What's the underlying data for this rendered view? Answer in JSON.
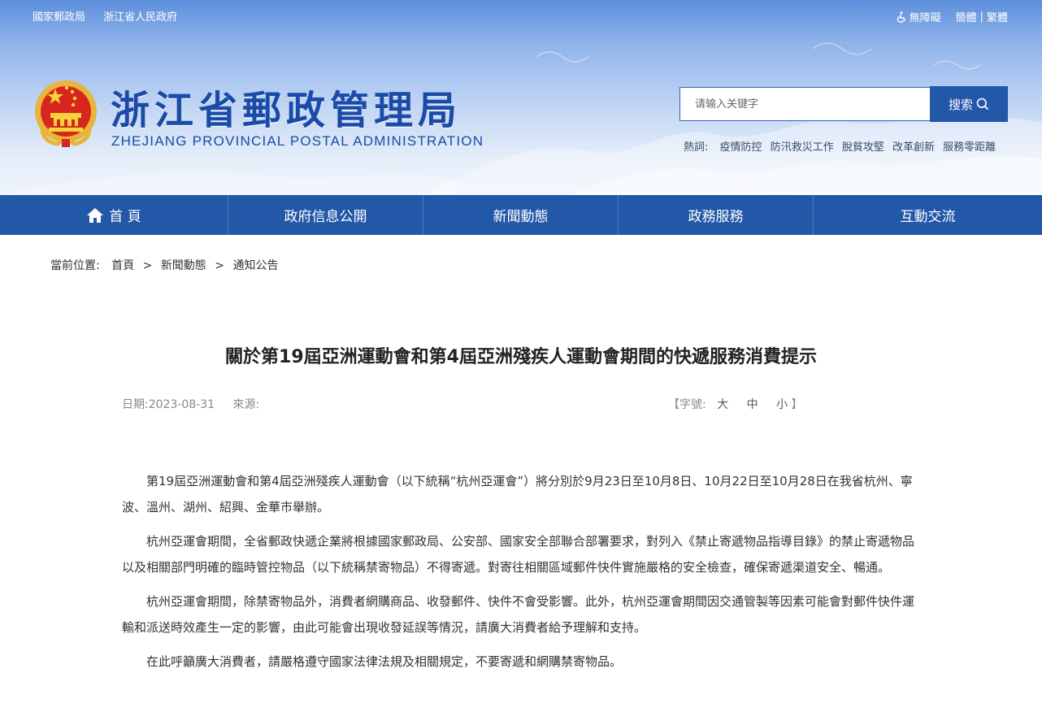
{
  "top": {
    "links": [
      "國家郵政局",
      "浙江省人民政府"
    ],
    "accessibility": "無障礙",
    "simplified": "簡體",
    "separator": "|",
    "traditional": "繁體"
  },
  "site": {
    "title": "浙江省郵政管理局",
    "subtitle": "ZHEJIANG PROVINCIAL POSTAL ADMINISTRATION"
  },
  "search": {
    "placeholder": "请输入关键字",
    "button": "搜索"
  },
  "hot": {
    "label": "熱詞:",
    "items": [
      "疫情防控",
      "防汛救災工作",
      "脫貧攻堅",
      "改革創新",
      "服務零距離"
    ]
  },
  "nav": {
    "items": [
      "首 頁",
      "政府信息公開",
      "新聞動態",
      "政務服務",
      "互動交流"
    ]
  },
  "breadcrumb": {
    "label": "當前位置:",
    "items": [
      "首頁",
      "新聞動態",
      "通知公告"
    ],
    "sep": ">"
  },
  "article": {
    "title": "關於第19屆亞洲運動會和第4屆亞洲殘疾人運動會期間的快遞服務消費提示",
    "date_label": "日期:",
    "date": "2023-08-31",
    "source_label": "來源:",
    "font_open": "【字號:",
    "font_large": "大",
    "font_medium": "中",
    "font_small": "小",
    "font_close": "】",
    "paragraphs": [
      "第19屆亞洲運動會和第4屆亞洲殘疾人運動會（以下統稱“杭州亞運會”）將分別於9月23日至10月8日、10月22日至10月28日在我省杭州、寧波、溫州、湖州、紹興、金華市舉辦。",
      "杭州亞運會期間，全省郵政快遞企業將根據國家郵政局、公安部、國家安全部聯合部署要求，對列入《禁止寄遞物品指導目錄》的禁止寄遞物品以及相關部門明確的臨時管控物品（以下統稱禁寄物品）不得寄遞。對寄往相關區域郵件快件實施嚴格的安全檢查，確保寄遞渠道安全、暢通。",
      "杭州亞運會期間，除禁寄物品外，消費者網購商品、收發郵件、快件不會受影響。此外，杭州亞運會期間因交通管製等因素可能會對郵件快件運輸和派送時效產生一定的影響，由此可能會出現收發延誤等情況，請廣大消費者給予理解和支持。",
      "在此呼籲廣大消費者，請嚴格遵守國家法律法規及相關規定，不要寄遞和網購禁寄物品。"
    ]
  }
}
